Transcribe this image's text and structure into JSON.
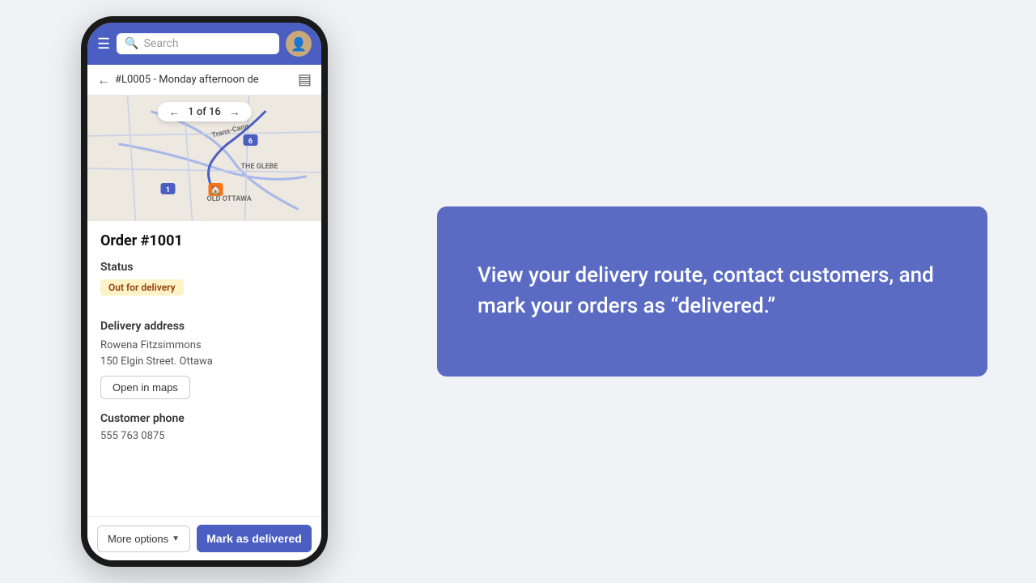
{
  "topbar": {
    "search_placeholder": "Search"
  },
  "breadcrumb": {
    "title": "#L0005 - Monday afternoon de"
  },
  "pagination": {
    "current": "1",
    "total": "16",
    "display": "1 of 16"
  },
  "order": {
    "title": "Order #1001",
    "status_label": "Status",
    "status_value": "Out for delivery",
    "delivery_address_label": "Delivery address",
    "customer_name": "Rowena Fitzsimmons",
    "address_line": "150 Elgin Street. Ottawa",
    "open_maps_label": "Open in maps",
    "customer_phone_label": "Customer phone",
    "phone_number": "555 763 0875"
  },
  "footer": {
    "more_options_label": "More options",
    "mark_delivered_label": "Mark as delivered"
  },
  "info_panel": {
    "text": "View your delivery route, contact customers, and mark your orders as “delivered.”"
  },
  "map": {
    "label1": "Trans-Cana",
    "label2": "THE GLEBE",
    "label3": "OLD OTTAWA"
  },
  "colors": {
    "brand": "#4a5fc1",
    "panel": "#5b6bc4",
    "status_bg": "#fef3c7",
    "status_text": "#92400e"
  }
}
